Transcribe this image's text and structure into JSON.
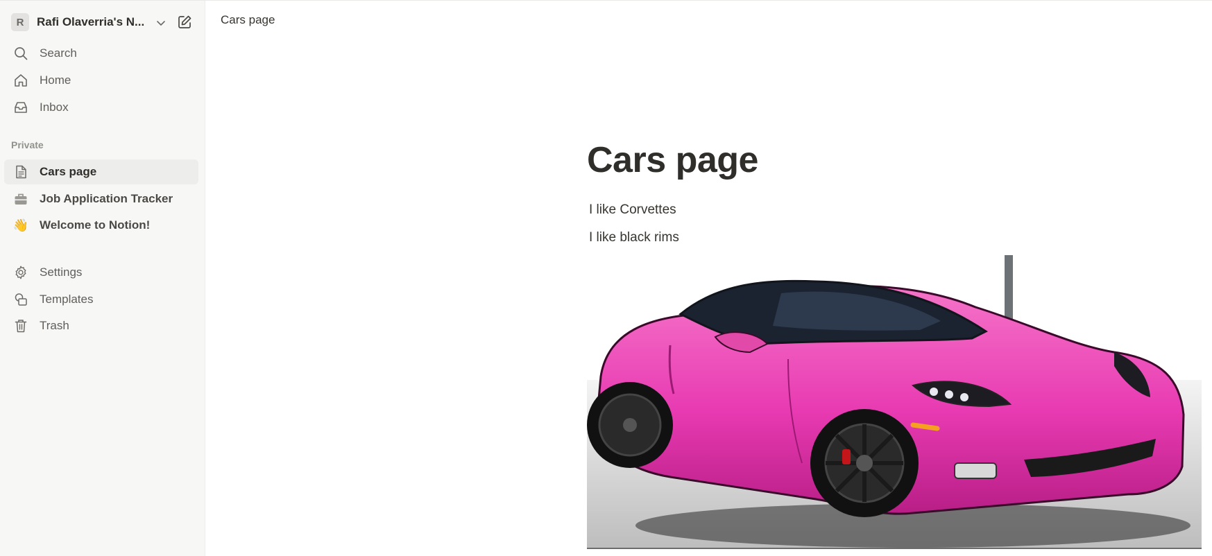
{
  "workspace": {
    "initial": "R",
    "name": "Rafi Olaverria's N...",
    "icons": {
      "chevron": "chevron-down-icon",
      "compose": "new-page-icon"
    }
  },
  "sidebar": {
    "top_items": [
      {
        "label": "Search",
        "icon": "search-icon"
      },
      {
        "label": "Home",
        "icon": "home-icon"
      },
      {
        "label": "Inbox",
        "icon": "inbox-icon"
      }
    ],
    "section_label": "Private",
    "pages": [
      {
        "label": "Cars page",
        "icon": "page-icon",
        "active": true
      },
      {
        "label": "Job Application Tracker",
        "icon": "briefcase-icon"
      },
      {
        "label": "Welcome to Notion!",
        "icon": "waving-hand-icon",
        "emoji": "👋"
      }
    ],
    "bottom_items": [
      {
        "label": "Settings",
        "icon": "gear-icon"
      },
      {
        "label": "Templates",
        "icon": "templates-icon"
      },
      {
        "label": "Trash",
        "icon": "trash-icon"
      }
    ]
  },
  "breadcrumb": "Cars page",
  "page": {
    "title": "Cars page",
    "paragraphs": [
      "I like Corvettes",
      "I like black rims"
    ]
  },
  "colors": {
    "sidebar_bg": "#f7f7f5",
    "active_item_bg": "#ededeb",
    "text": "#37352f",
    "car_pink": "#e93bb4"
  }
}
